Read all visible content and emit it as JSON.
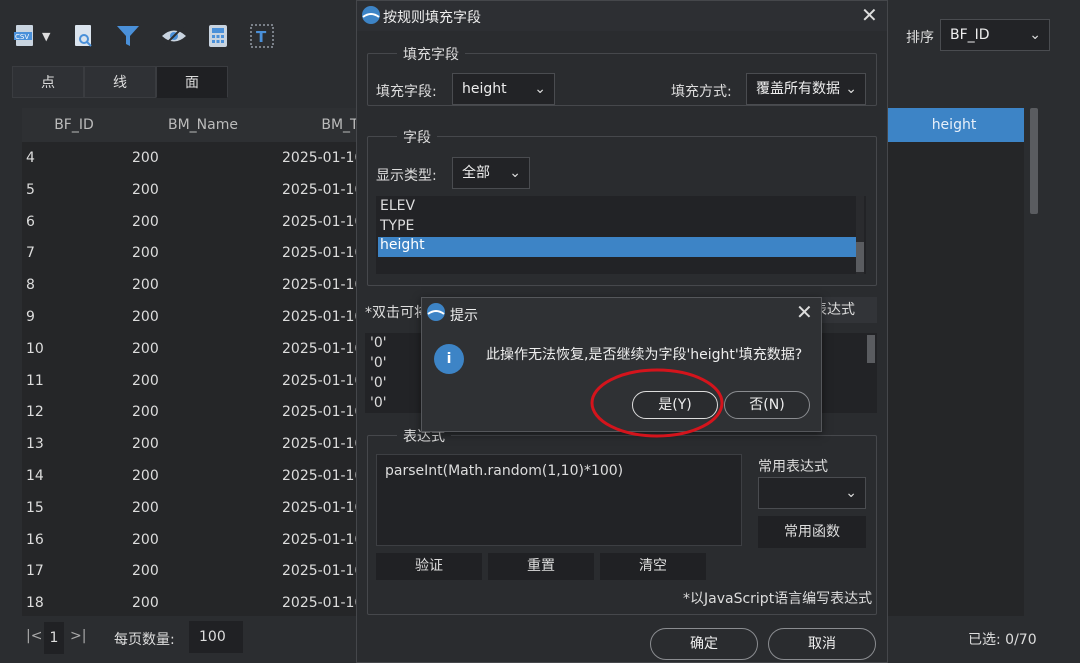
{
  "toolbar": {
    "icons": [
      "csv-export-icon",
      "dropdown-caret-icon",
      "search-document-icon",
      "filter-icon",
      "eye-icon",
      "calculator-icon",
      "text-icon"
    ]
  },
  "tabs": [
    "点",
    "线",
    "面"
  ],
  "sort": {
    "label": "排序",
    "value": "BF_ID"
  },
  "grid": {
    "columns": [
      "BF_ID",
      "BM_Name",
      "BM_T",
      "height"
    ],
    "rows": [
      [
        "4",
        "200",
        "2025-01-10"
      ],
      [
        "5",
        "200",
        "2025-01-10"
      ],
      [
        "6",
        "200",
        "2025-01-10"
      ],
      [
        "7",
        "200",
        "2025-01-10"
      ],
      [
        "8",
        "200",
        "2025-01-10"
      ],
      [
        "9",
        "200",
        "2025-01-10"
      ],
      [
        "10",
        "200",
        "2025-01-10"
      ],
      [
        "11",
        "200",
        "2025-01-10"
      ],
      [
        "12",
        "200",
        "2025-01-10"
      ],
      [
        "13",
        "200",
        "2025-01-10"
      ],
      [
        "14",
        "200",
        "2025-01-10"
      ],
      [
        "15",
        "200",
        "2025-01-10"
      ],
      [
        "16",
        "200",
        "2025-01-10"
      ],
      [
        "17",
        "200",
        "2025-01-10"
      ],
      [
        "18",
        "200",
        "2025-01-10"
      ]
    ]
  },
  "pager": {
    "first": "|<",
    "page": "1",
    "last": ">|",
    "per_page_label": "每页数量:",
    "per_page": "100",
    "selected": "已选: 0/70"
  },
  "dialog": {
    "title": "按规则填充字段",
    "fill_group": "填充字段",
    "fill_field_label": "填充字段:",
    "fill_field_value": "height",
    "fill_mode_label": "填充方式:",
    "fill_mode_value": "覆盖所有数据",
    "field_group": "字段",
    "display_type_label": "显示类型:",
    "display_type_value": "全部",
    "fields": [
      "ELEV",
      "TYPE",
      "height"
    ],
    "dbl_hint": "*双击可将",
    "expr_btn_tail": "表达式",
    "values": [
      "'0'",
      "'0'",
      "'0'",
      "'0'"
    ],
    "expr_group": "表达式",
    "expr_value": "parseInt(Math.random(1,10)*100)",
    "common_expr_label": "常用表达式",
    "common_func": "常用函数",
    "verify": "验证",
    "reset": "重置",
    "clear": "清空",
    "js_hint": "*以JavaScript语言编写表达式",
    "ok": "确定",
    "cancel": "取消"
  },
  "msgbox": {
    "title": "提示",
    "text": "此操作无法恢复,是否继续为字段'height'填充数据?",
    "yes": "是(Y)",
    "no": "否(N)"
  },
  "colors": {
    "accent": "#3d84c6",
    "highlight_circle": "#d4141c"
  }
}
